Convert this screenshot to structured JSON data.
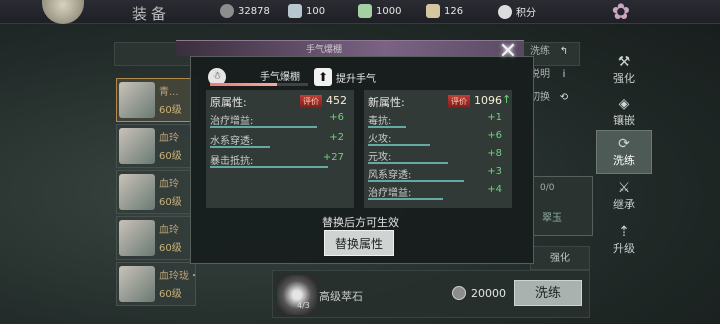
{
  "header": {
    "title": "装备",
    "resources": [
      {
        "icon": "coin-icon",
        "value": "32878",
        "color": "#8d8d8d"
      },
      {
        "icon": "ingot-icon",
        "value": "100",
        "color": "#b7c7d0"
      },
      {
        "icon": "jade-icon",
        "value": "1000",
        "color": "#a4d0a4"
      },
      {
        "icon": "scroll-icon",
        "value": "126",
        "color": "#d6c6a0"
      },
      {
        "icon": "points-icon",
        "value": "积分",
        "color": "#dcdcdc"
      }
    ]
  },
  "item_list": [
    {
      "name": "青...",
      "level": "60级",
      "selected": true
    },
    {
      "name": "血玲",
      "level": "60级",
      "selected": false
    },
    {
      "name": "血玲",
      "level": "60级",
      "selected": false
    },
    {
      "name": "血玲",
      "level": "60级",
      "selected": false
    },
    {
      "name": "血玲珑・链",
      "level": "60级",
      "selected": false
    }
  ],
  "sidebar": {
    "items": [
      {
        "glyph": "⚒",
        "label": "强化",
        "active": false
      },
      {
        "glyph": "◈",
        "label": "镶嵌",
        "active": false
      },
      {
        "glyph": "⟳",
        "label": "洗练",
        "active": true
      },
      {
        "glyph": "⚔",
        "label": "继承",
        "active": false
      },
      {
        "glyph": "⇡",
        "label": "升级",
        "active": false
      }
    ]
  },
  "background_panel": {
    "right_options": [
      {
        "label": "洗练",
        "icon": "↰"
      },
      {
        "label": "说明",
        "icon": "i"
      },
      {
        "label": "切换",
        "icon": "⟲"
      }
    ],
    "slot_count": "0/0",
    "slot_name": "翠玉",
    "strengthen_label": "强化"
  },
  "bottom": {
    "stone_name": "高级萃石",
    "stone_count": "4/3",
    "cost": "20000",
    "refine_button": "洗练"
  },
  "modal": {
    "header_text": "手气爆棚",
    "skill": {
      "name": "手气爆棚",
      "badge": "☃",
      "progress": 0.68
    },
    "upgrade_label": "提升手气",
    "old": {
      "label": "原属性:",
      "tag": "评价",
      "score": "452",
      "rows": [
        {
          "name": "治疗增益:",
          "value": "+6",
          "bar": 0.8
        },
        {
          "name": "水系穿透:",
          "value": "+2",
          "bar": 0.45
        },
        {
          "name": "暴击抵抗:",
          "value": "+27",
          "bar": 0.88
        }
      ]
    },
    "new": {
      "label": "新属性:",
      "tag": "评价",
      "score": "1096",
      "score_arrow": "↑",
      "rows": [
        {
          "name": "毒抗:",
          "value": "+1",
          "bar": 0.28
        },
        {
          "name": "火攻:",
          "value": "+6",
          "bar": 0.46
        },
        {
          "name": "元攻:",
          "value": "+8",
          "bar": 0.6
        },
        {
          "name": "风系穿透:",
          "value": "+3",
          "bar": 0.72
        },
        {
          "name": "治疗增益:",
          "value": "+4",
          "bar": 0.56
        }
      ]
    },
    "note": "替换后方可生效",
    "replace_button": "替换属性",
    "close_icon": "close-icon"
  }
}
